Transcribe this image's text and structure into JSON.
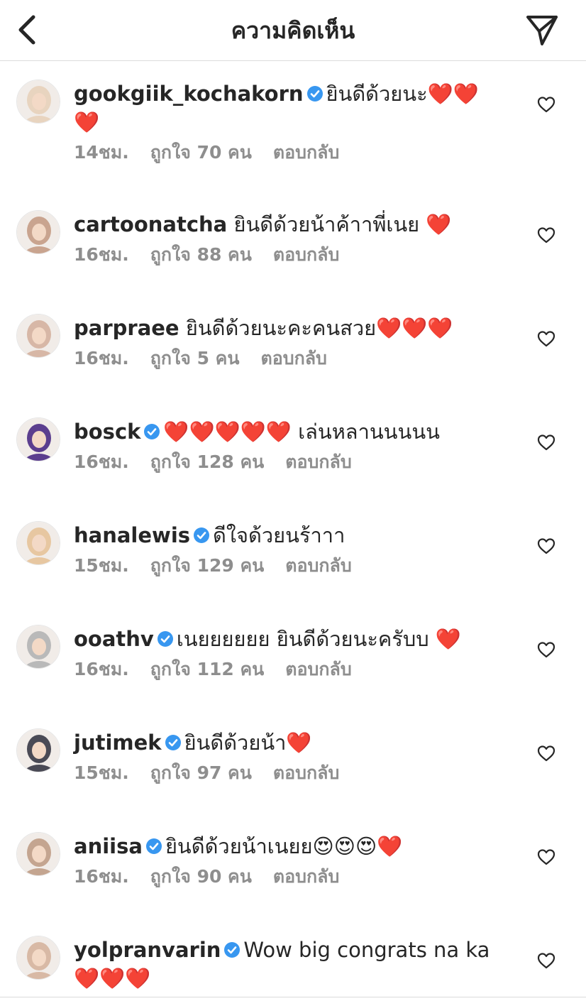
{
  "header": {
    "title": "ความคิดเห็น"
  },
  "comments": [
    {
      "username": "gookgiik_kochakorn",
      "verified": true,
      "text": "ยินดีด้วยนะ❤️❤️❤️",
      "time": "14ชม.",
      "likes": "ถูกใจ 70 คน",
      "reply": "ตอบกลับ",
      "avatar_color": "#e8d4bf"
    },
    {
      "username": "cartoonatcha",
      "verified": false,
      "text": "ยินดีด้วยน้าค้าาพี่เนย ❤️",
      "time": "16ชม.",
      "likes": "ถูกใจ 88 คน",
      "reply": "ตอบกลับ",
      "avatar_color": "#c9a48f"
    },
    {
      "username": "parpraee",
      "verified": false,
      "text": "ยินดีด้วยนะคะคนสวย❤️❤️❤️",
      "time": "16ชม.",
      "likes": "ถูกใจ 5 คน",
      "reply": "ตอบกลับ",
      "avatar_color": "#d7b7a6"
    },
    {
      "username": "bosck",
      "verified": true,
      "text": "❤️❤️❤️❤️❤️ เล่นหลานนนนน",
      "time": "16ชม.",
      "likes": "ถูกใจ 128 คน",
      "reply": "ตอบกลับ",
      "avatar_color": "#5b3e8e"
    },
    {
      "username": "hanalewis",
      "verified": true,
      "text": "ดีใจด้วยนร้าาา",
      "time": "15ชม.",
      "likes": "ถูกใจ 129 คน",
      "reply": "ตอบกลับ",
      "avatar_color": "#e7c7a1"
    },
    {
      "username": "ooathv",
      "verified": true,
      "text": "เนยยยยยย ยินดีด้วยนะครับบ ❤️",
      "time": "16ชม.",
      "likes": "ถูกใจ 112 คน",
      "reply": "ตอบกลับ",
      "avatar_color": "#b9b9b9"
    },
    {
      "username": "jutimek",
      "verified": true,
      "text": "ยินดีด้วยน้า❤️",
      "time": "15ชม.",
      "likes": "ถูกใจ 97 คน",
      "reply": "ตอบกลับ",
      "avatar_color": "#4a4a55"
    },
    {
      "username": "aniisa",
      "verified": true,
      "text": "ยินดีด้วยน้าเนยย😍😍😍❤️",
      "time": "16ชม.",
      "likes": "ถูกใจ 90 คน",
      "reply": "ตอบกลับ",
      "avatar_color": "#c4a590"
    },
    {
      "username": "yolpranvarin",
      "verified": true,
      "text": "Wow big congrats na ka ❤️❤️❤️",
      "time": "",
      "likes": "",
      "reply": "",
      "avatar_color": "#d8b9a5"
    }
  ],
  "colors": {
    "verified": "#3897f0",
    "heart": "#e0142d",
    "meta": "#8e8e8e"
  }
}
